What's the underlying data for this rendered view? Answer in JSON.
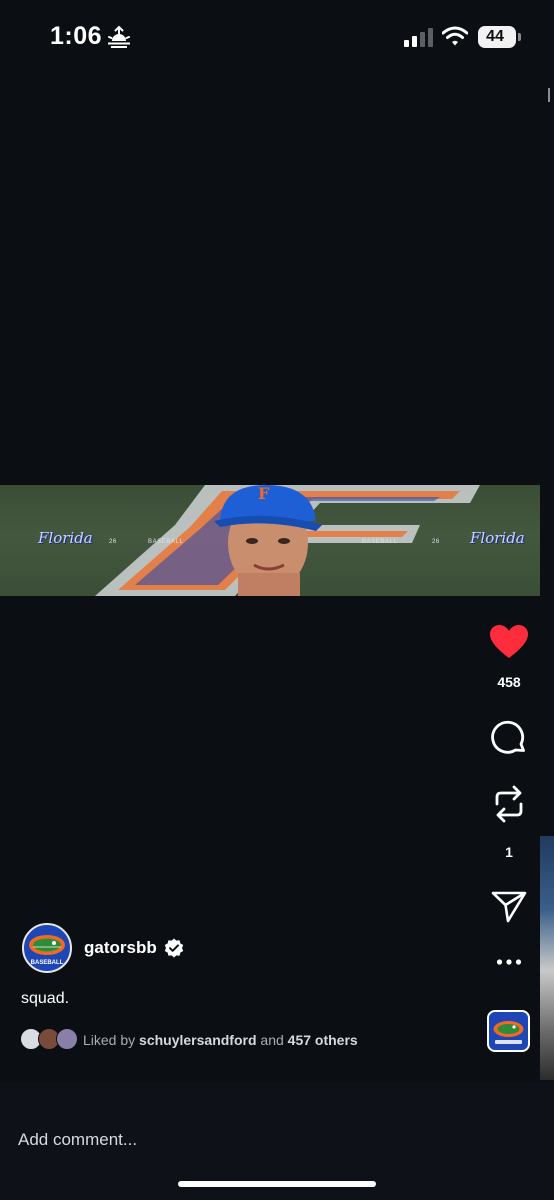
{
  "status_bar": {
    "time": "1:06",
    "battery": "44"
  },
  "banner": {
    "brand_left": "Florida",
    "brand_right": "Florida",
    "number_left": "26",
    "number_right": "26",
    "word_left": "BASEBALL",
    "word_right": "BASEBALL"
  },
  "actions": {
    "like_count": "458",
    "repost_count": "1",
    "like_color": "#ff2d3b"
  },
  "post": {
    "username": "gatorsbb",
    "caption": "squad.",
    "liked_prefix": "Liked by",
    "liked_user": "schuylersandford",
    "liked_and": "and",
    "liked_others": "457 others",
    "avatar_label": "BASEBALL"
  },
  "comment_bar": {
    "placeholder": "Add comment..."
  },
  "colors": {
    "background": "#0b0f14",
    "gator_blue": "#1e47b5",
    "gator_orange": "#f26a21"
  }
}
